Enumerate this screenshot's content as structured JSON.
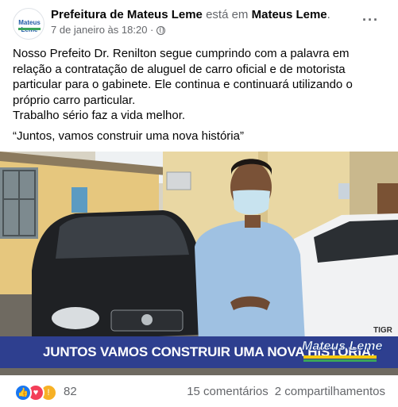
{
  "post": {
    "page_name": "Prefeitura de Mateus Leme",
    "is_at": " está em ",
    "location": "Mateus Leme",
    "location_suffix": ".",
    "timestamp": "7 de janeiro às 18:20 ·",
    "avatar_text": "Mateus Leme",
    "more_label": "···",
    "body_lines": [
      "Nosso Prefeito Dr. Renilton segue cumprindo com a palavra em relação a contratação de aluguel de carro oficial e de motorista particular para o gabinete. Ele continua e continuará utilizando o próprio carro particular.",
      "Trabalho sério faz a vida melhor."
    ],
    "quote": "“Juntos, vamos construir uma nova história”"
  },
  "photo": {
    "banner_text": "JUNTOS VAMOS CONSTRUIR UMA NOVA HISTÓRIA.",
    "logo_text": "Mateus Leme",
    "plate_text": "TIGR"
  },
  "reactions": {
    "count": "82",
    "comments": "15 comentários",
    "shares": "2 compartilhamentos",
    "types": [
      "like-icon",
      "love-icon",
      "wow-icon"
    ]
  },
  "colors": {
    "banner": "#2e3f8f",
    "like": "#1877f2",
    "love": "#f33e58",
    "wow": "#f7b125",
    "muted": "#65676b"
  }
}
